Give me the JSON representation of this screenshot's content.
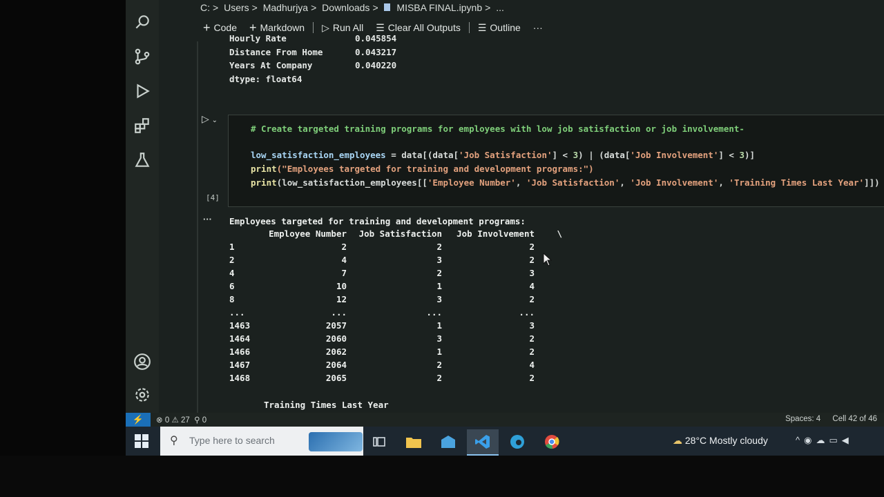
{
  "breadcrumb": {
    "items": [
      "C:",
      "Users",
      "Madhurjya",
      "Downloads"
    ],
    "file": "MISBA FINAL.ipynb",
    "more": "..."
  },
  "toolbar": {
    "code": "Code",
    "markdown": "Markdown",
    "run_all": "Run All",
    "clear_outputs": "Clear All Outputs",
    "outline": "Outline",
    "more": "···"
  },
  "prev_output": {
    "rows": [
      {
        "label": "Hourly Rate",
        "value": "0.045854"
      },
      {
        "label": "Distance From Home",
        "value": "0.043217"
      },
      {
        "label": "Years At Company",
        "value": "0.040220"
      }
    ],
    "dtype": "dtype: float64"
  },
  "cell": {
    "count": "[4]",
    "comment": "# Create targeted training programs for employees with low job satisfaction or job involvement-",
    "line2_var": "low_satisfaction_employees",
    "line2_rest_a": " = data[(data[",
    "line2_str1": "'Job Satisfaction'",
    "line2_rest_b": "] < ",
    "line2_num1": "3",
    "line2_rest_c": ") | (data[",
    "line2_str2": "'Job Involvement'",
    "line2_rest_d": "] < ",
    "line2_num2": "3",
    "line2_rest_e": ")]",
    "line3_fn": "print",
    "line3_str": "(\"Employees targeted for training and development programs:\")",
    "line4_fn": "print",
    "line4_open": "(low_satisfaction_employees[[",
    "line4_s1": "'Employee Number'",
    "line4_s2": "'Job Satisfaction'",
    "line4_s3": "'Job Involvement'",
    "line4_s4": "'Training Times Last Year'",
    "line4_close": "]])",
    "comma": ", "
  },
  "output": {
    "more": "···",
    "title": "Employees targeted for training and development programs:",
    "headers": [
      "",
      "Employee Number",
      "Job Satisfaction",
      "Job Involvement",
      "\\"
    ],
    "rows": [
      [
        "1",
        "2",
        "2",
        "2"
      ],
      [
        "2",
        "4",
        "3",
        "2"
      ],
      [
        "4",
        "7",
        "2",
        "3"
      ],
      [
        "6",
        "10",
        "1",
        "4"
      ],
      [
        "8",
        "12",
        "3",
        "2"
      ],
      [
        "...",
        "...",
        "...",
        "..."
      ],
      [
        "1463",
        "2057",
        "1",
        "3"
      ],
      [
        "1464",
        "2060",
        "3",
        "2"
      ],
      [
        "1466",
        "2062",
        "1",
        "2"
      ],
      [
        "1467",
        "2064",
        "2",
        "4"
      ],
      [
        "1468",
        "2065",
        "2",
        "2"
      ]
    ],
    "continued_header": "Training Times Last Year"
  },
  "status": {
    "errors": "0",
    "warnings": "27",
    "ports": "0",
    "spaces": "Spaces: 4",
    "cell": "Cell 42 of 46"
  },
  "taskbar": {
    "search_placeholder": "Type here to search",
    "weather": "28°C  Mostly cloudy"
  },
  "colors": {
    "accent": "#1a6fb8",
    "comment": "#7fcf7a",
    "string": "#e4a27e"
  }
}
